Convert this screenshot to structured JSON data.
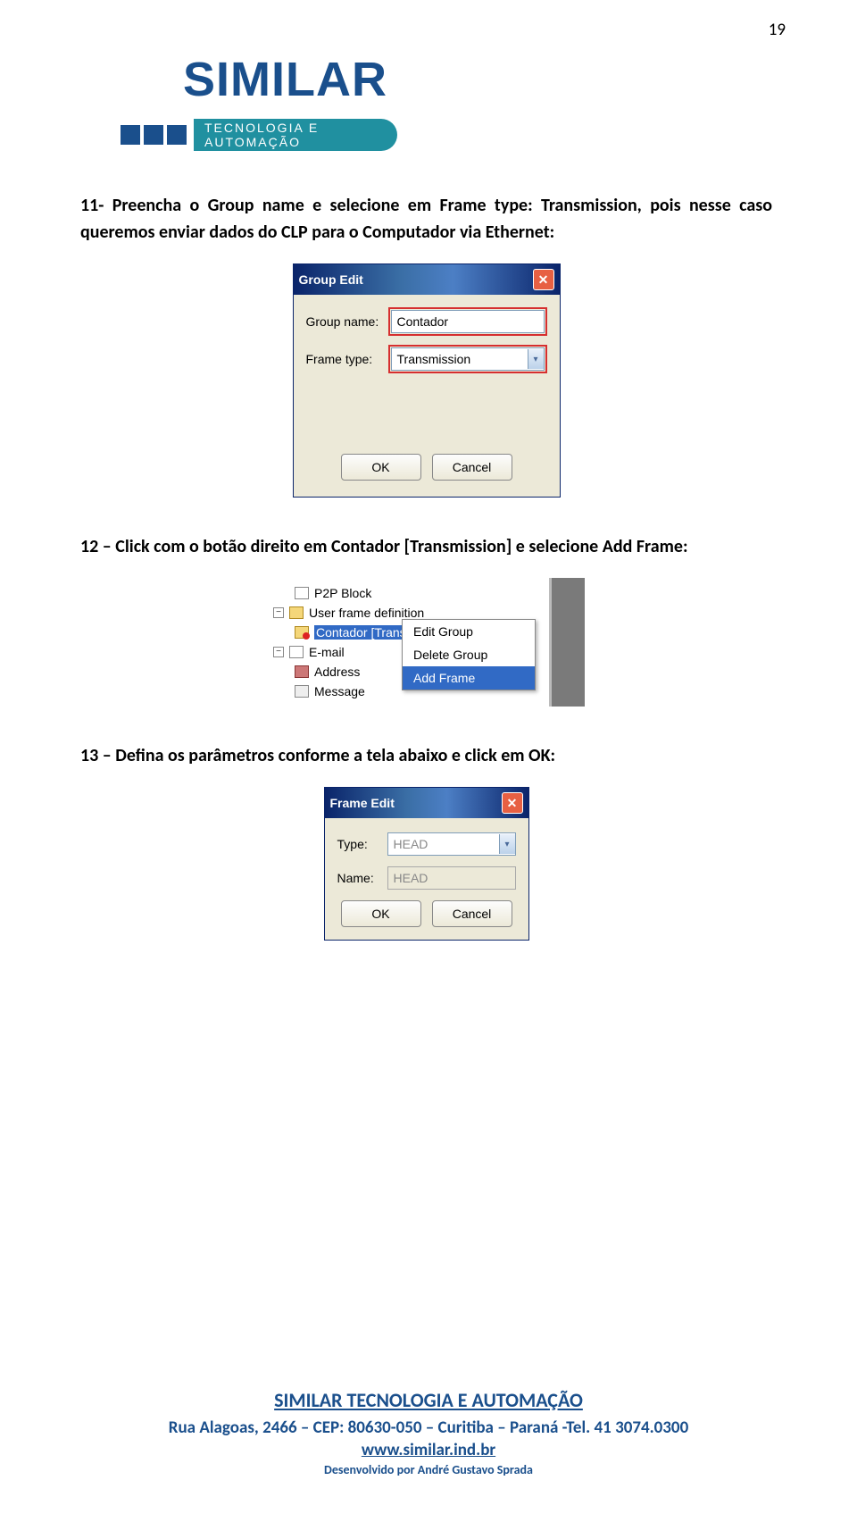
{
  "page_number": "19",
  "logo": {
    "brand": "SIMILAR",
    "tagline": "TECNOLOGIA E AUTOMAÇÃO"
  },
  "step11": "11- Preencha o Group name e selecione em Frame type: Transmission, pois nesse caso queremos enviar dados do CLP para o Computador via Ethernet:",
  "dialog_group_edit": {
    "title": "Group Edit",
    "group_name_label": "Group name:",
    "group_name_value": "Contador",
    "frame_type_label": "Frame type:",
    "frame_type_value": "Transmission",
    "ok": "OK",
    "cancel": "Cancel"
  },
  "step12": "12 – Click com o botão direito em Contador [Transmission] e selecione Add Frame:",
  "tree": {
    "items": [
      "P2P Block",
      "User frame definition",
      "Contador [Transmission]",
      "E-mail",
      "Address",
      "Message"
    ],
    "context_menu": {
      "edit": "Edit Group",
      "delete": "Delete Group",
      "add": "Add Frame"
    }
  },
  "step13": "13 – Defina os parâmetros conforme a tela abaixo e click em OK:",
  "dialog_frame_edit": {
    "title": "Frame Edit",
    "type_label": "Type:",
    "type_value": "HEAD",
    "name_label": "Name:",
    "name_value": "HEAD",
    "ok": "OK",
    "cancel": "Cancel"
  },
  "footer": {
    "title": "SIMILAR TECNOLOGIA E AUTOMAÇÃO",
    "address": "Rua Alagoas, 2466 – CEP: 80630-050 – Curitiba – Paraná -Tel. 41 3074.0300",
    "url": "www.similar.ind.br",
    "dev": "Desenvolvido por André Gustavo Sprada"
  }
}
